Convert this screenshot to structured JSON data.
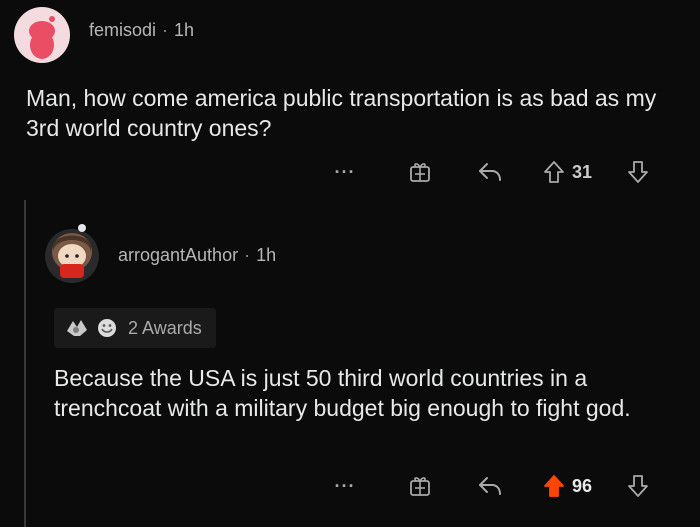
{
  "top_comment": {
    "username": "femisodi",
    "separator": "·",
    "time": "1h",
    "body": "Man, how come america public transportation is as bad as my 3rd world country ones?",
    "actions": {
      "more_label": "···",
      "score": "31",
      "upvoted": false
    }
  },
  "reply": {
    "username": "arrogantAuthor",
    "separator": "·",
    "time": "1h",
    "awards_label": "2 Awards",
    "body": "Because the USA is just 50 third world countries in a trenchcoat with a military budget big enough to fight god.",
    "actions": {
      "more_label": "···",
      "score": "96",
      "upvoted": true
    }
  },
  "colors": {
    "background": "#0b0b0b",
    "upvote_active": "#ff4500",
    "text": "#e6e8ea",
    "muted": "#a8aaab"
  },
  "icons": [
    "avatar-snoo-icon",
    "gift-award-icon",
    "reply-arrow-icon",
    "upvote-arrow-icon",
    "downvote-arrow-icon",
    "award-badge-icon"
  ]
}
